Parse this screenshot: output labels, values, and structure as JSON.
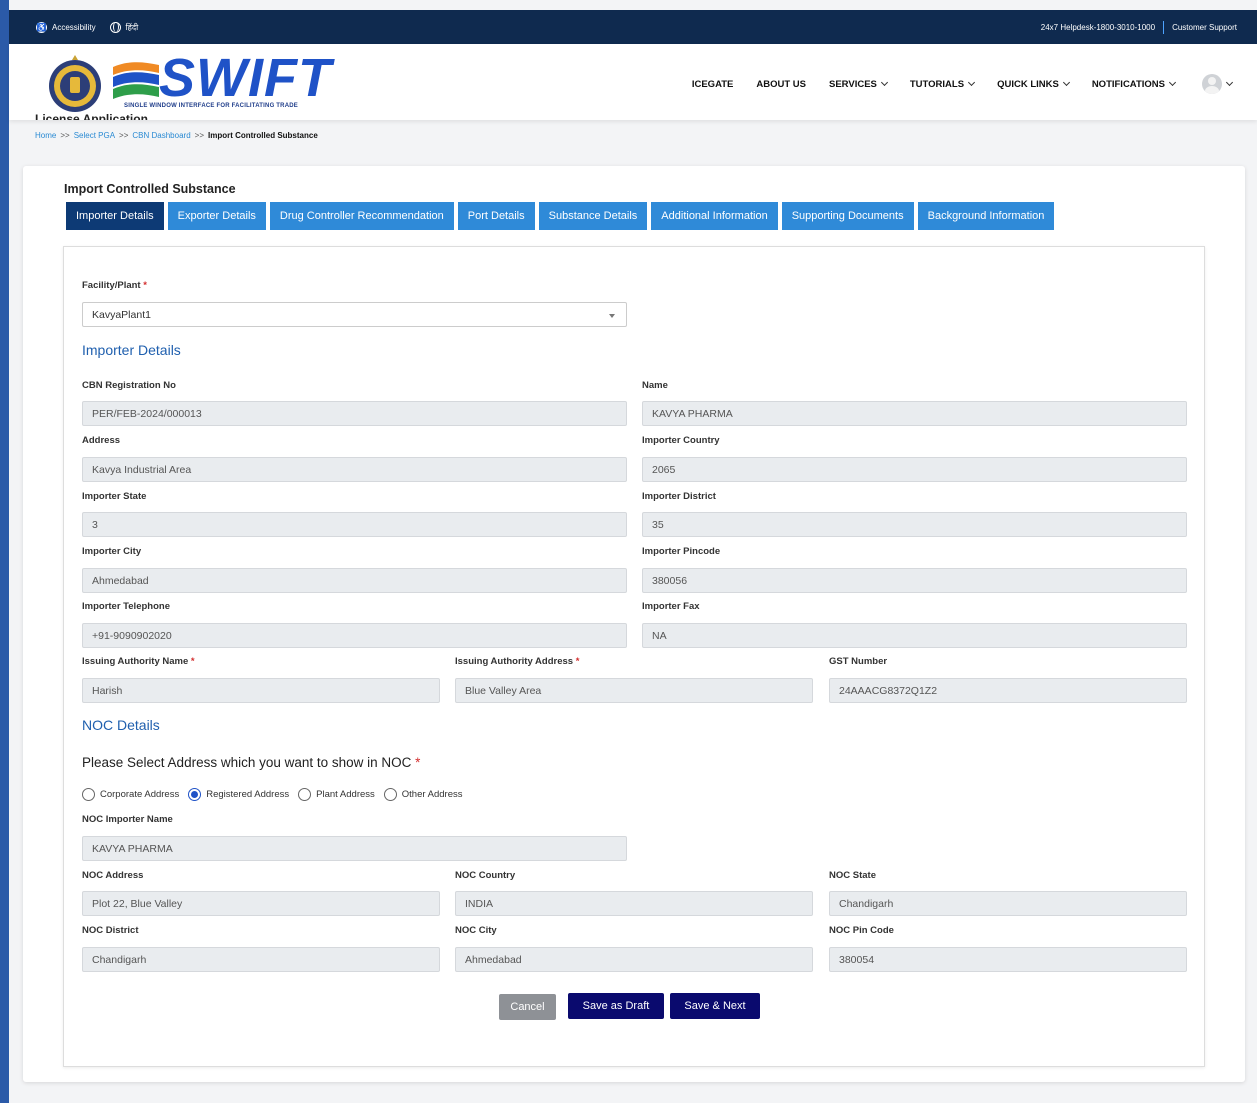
{
  "topbar": {
    "accessibility": "Accessibility",
    "hindi": "हिंदी",
    "helpdesk": "24x7 Helpdesk-1800-3010-1000",
    "support": "Customer Support"
  },
  "brand": {
    "name": "SWIFT",
    "tagline": "SINGLE WINDOW INTERFACE FOR FACILITATING TRADE"
  },
  "nav": {
    "items": [
      "ICEGATE",
      "ABOUT US",
      "SERVICES",
      "TUTORIALS",
      "QUICK LINKS",
      "NOTIFICATIONS"
    ]
  },
  "page": {
    "heading": "License Application",
    "breadcrumb": [
      "Home",
      "Select PGA",
      "CBN Dashboard",
      "Import Controlled Substance"
    ],
    "breadcrumb_sep": ">>"
  },
  "form": {
    "title": "Import Controlled Substance",
    "tabs": [
      "Importer Details",
      "Exporter Details",
      "Drug Controller Recommendation",
      "Port Details",
      "Substance Details",
      "Additional Information",
      "Supporting Documents",
      "Background Information"
    ],
    "facility_label": "Facility/Plant",
    "facility_value": "KavyaPlant1",
    "importer_section": "Importer Details",
    "fields": {
      "cbn_label": "CBN Registration No",
      "cbn_value": "PER/FEB-2024/000013",
      "name_label": "Name",
      "name_value": "KAVYA PHARMA",
      "address_label": "Address",
      "address_value": "Kavya Industrial Area",
      "country_label": "Importer Country",
      "country_value": "2065",
      "state_label": "Importer State",
      "state_value": "3",
      "district_label": "Importer District",
      "district_value": "35",
      "city_label": "Importer City",
      "city_value": "Ahmedabad",
      "pincode_label": "Importer Pincode",
      "pincode_value": "380056",
      "telephone_label": "Importer Telephone",
      "telephone_value": "+91-9090902020",
      "fax_label": "Importer Fax",
      "fax_value": "NA",
      "issuing_name_label": "Issuing Authority Name",
      "issuing_name_value": "Harish",
      "issuing_address_label": "Issuing Authority Address",
      "issuing_address_value": "Blue Valley Area",
      "gst_label": "GST Number",
      "gst_value": "24AAACG8372Q1Z2"
    },
    "noc_section": "NOC Details",
    "noc_question": "Please Select Address which you want to show in NOC",
    "radio_options": [
      "Corporate Address",
      "Registered Address",
      "Plant Address",
      "Other Address"
    ],
    "radio_selected": "Registered Address",
    "noc": {
      "name_label": "NOC Importer Name",
      "name_value": "KAVYA PHARMA",
      "address_label": "NOC Address",
      "address_value": "Plot 22, Blue Valley",
      "country_label": "NOC Country",
      "country_value": "INDIA",
      "state_label": "NOC State",
      "state_value": "Chandigarh",
      "district_label": "NOC District",
      "district_value": "Chandigarh",
      "city_label": "NOC City",
      "city_value": "Ahmedabad",
      "pin_label": "NOC Pin Code",
      "pin_value": "380054"
    },
    "buttons": {
      "cancel": "Cancel",
      "draft": "Save as Draft",
      "next": "Save & Next"
    }
  }
}
